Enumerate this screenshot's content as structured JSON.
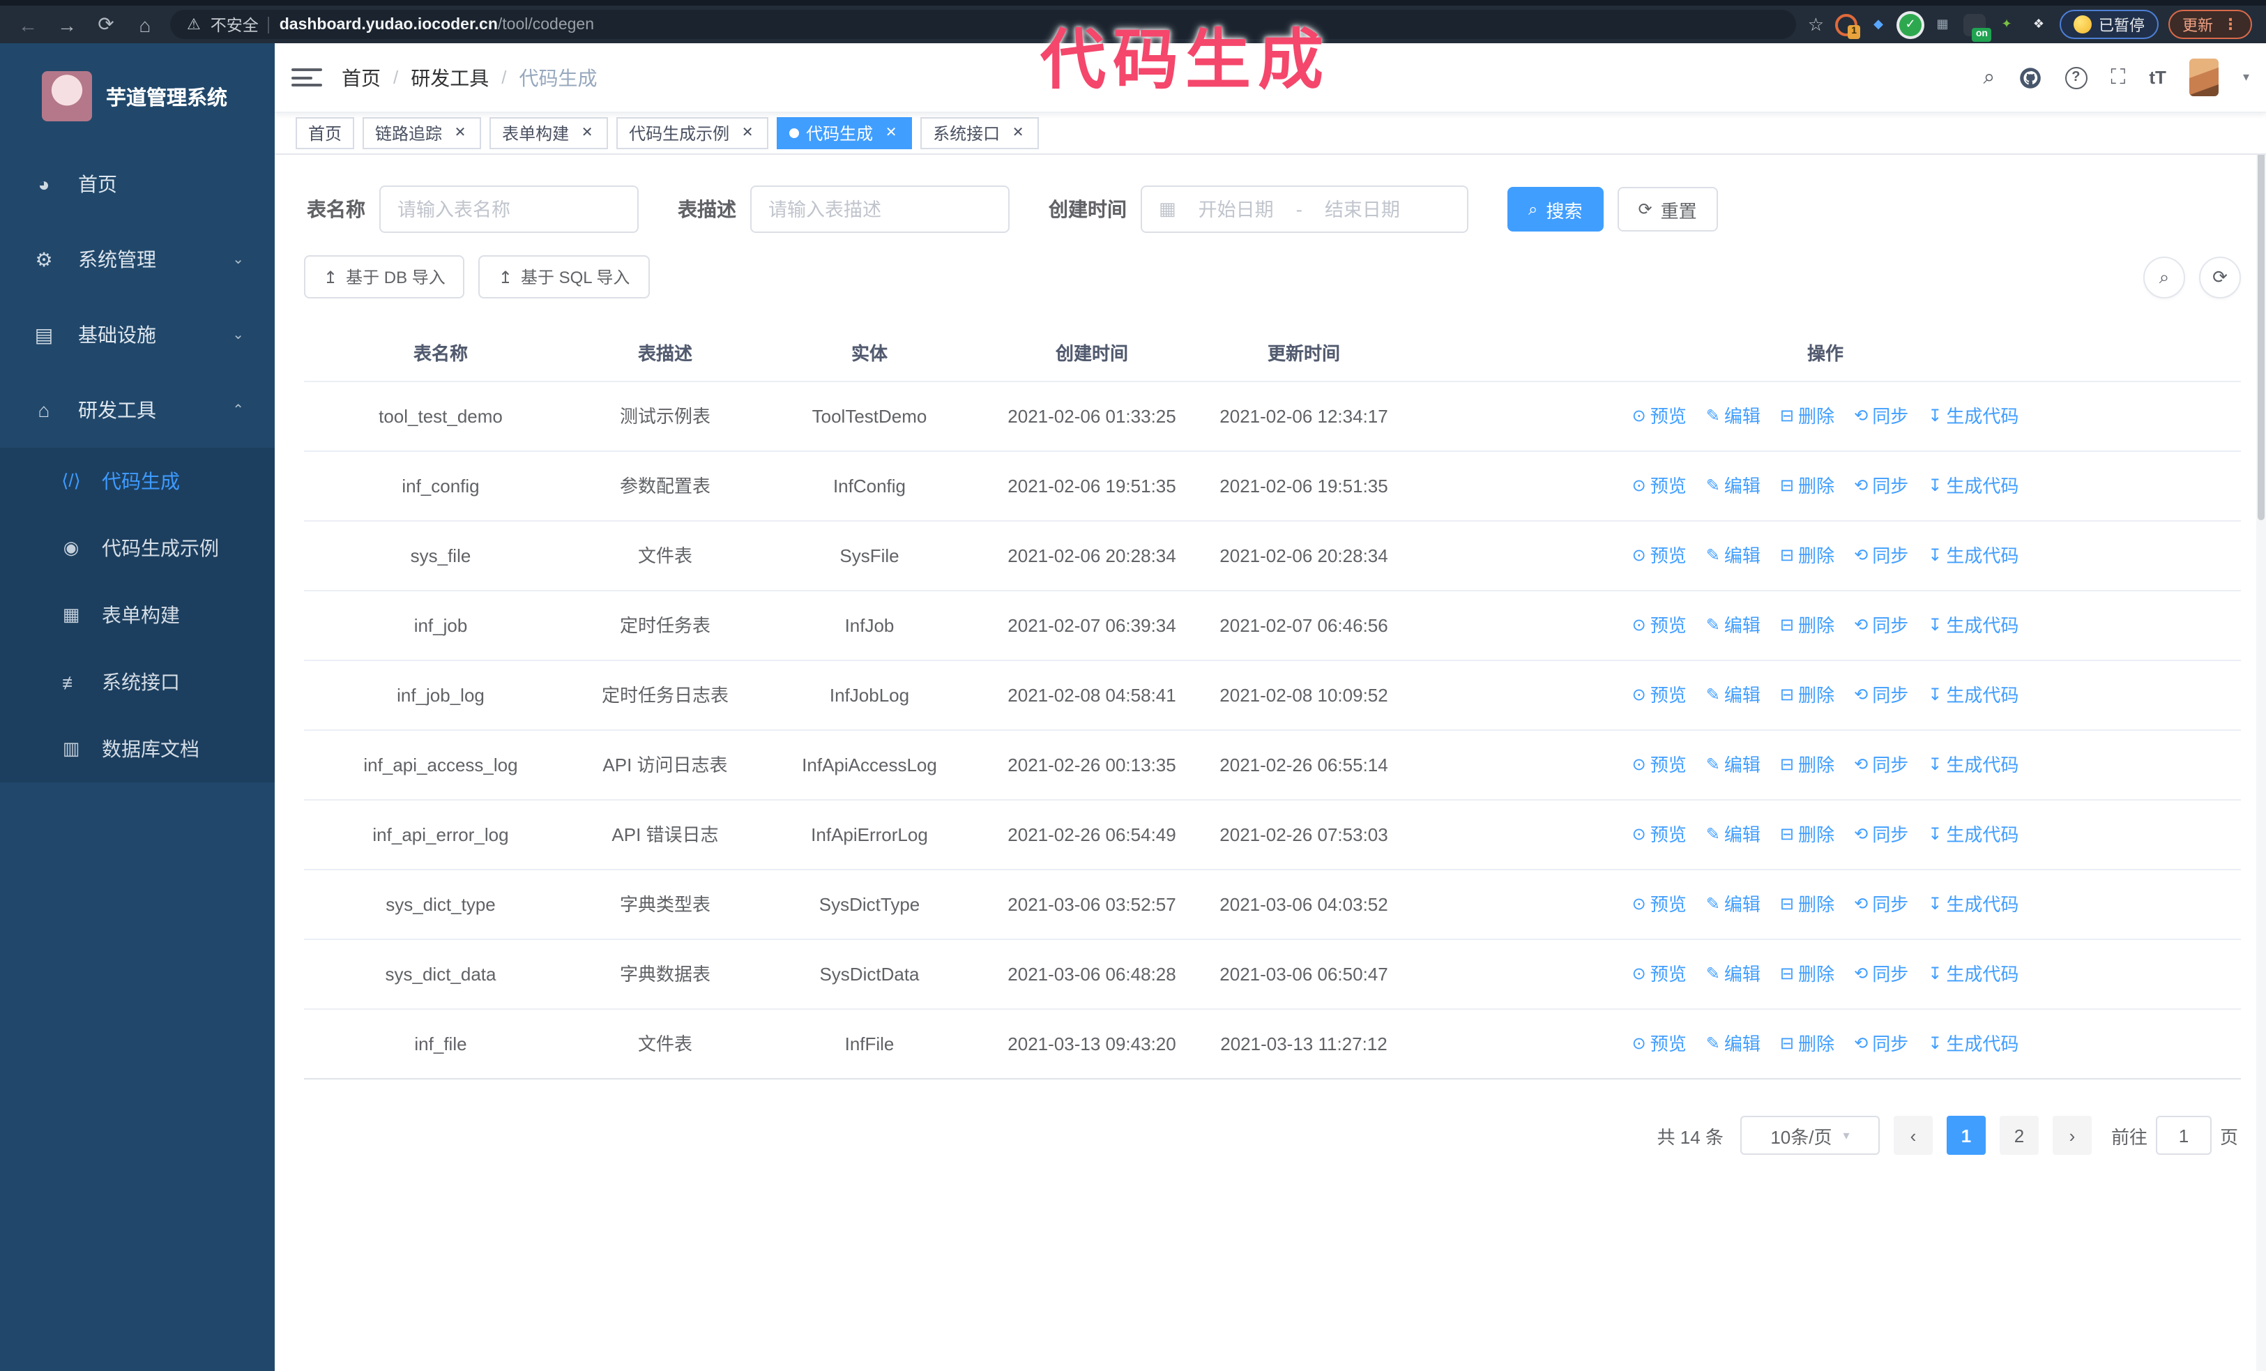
{
  "browser": {
    "security_label": "不安全",
    "url_host": "dashboard.yudao.iocoder.cn",
    "url_path": "/tool/codegen",
    "extension_badge": "1",
    "extension_on_badge": "on",
    "paused_chip": "已暂停",
    "update_chip": "更新",
    "icons": {
      "back": "←",
      "forward": "→",
      "reload": "⟳",
      "home": "⌂",
      "warning": "⚠",
      "star": "☆",
      "menu_dots": "⋮",
      "gem": "◆",
      "check": "✓",
      "grid": "▦",
      "sprout": "✦",
      "puzzle": "❖"
    }
  },
  "annotation": {
    "text": "代码生成"
  },
  "sidebar": {
    "app_title": "芋道管理系统",
    "items": [
      {
        "label": "首页",
        "icon": "dashboard-icon",
        "glyph": "◕"
      },
      {
        "label": "系统管理",
        "icon": "gear-icon",
        "glyph": "⚙",
        "chevron": "⌄"
      },
      {
        "label": "基础设施",
        "icon": "monitor-icon",
        "glyph": "▤",
        "chevron": "⌄"
      },
      {
        "label": "研发工具",
        "icon": "toolbox-icon",
        "glyph": "⌂",
        "chevron": "⌃"
      }
    ],
    "sub_items": [
      {
        "label": "代码生成",
        "icon": "code-icon",
        "glyph": "⟨/⟩",
        "active": true
      },
      {
        "label": "代码生成示例",
        "icon": "shield-check-icon",
        "glyph": "◉",
        "active": false
      },
      {
        "label": "表单构建",
        "icon": "form-icon",
        "glyph": "▦",
        "active": false
      },
      {
        "label": "系统接口",
        "icon": "sliders-icon",
        "glyph": "≢",
        "active": false
      },
      {
        "label": "数据库文档",
        "icon": "database-doc-icon",
        "glyph": "▥",
        "active": false
      }
    ]
  },
  "navbar": {
    "breadcrumb": [
      "首页",
      "研发工具",
      "代码生成"
    ],
    "separator": "/",
    "icons": {
      "search_glyph": "⌕",
      "fullscreen_glyph": "⛶",
      "fontsize_glyph": "tT",
      "help_glyph": "?",
      "caret": "▾"
    }
  },
  "tabs": [
    {
      "label": "首页",
      "closable": false,
      "active": false
    },
    {
      "label": "链路追踪",
      "closable": true,
      "active": false
    },
    {
      "label": "表单构建",
      "closable": true,
      "active": false
    },
    {
      "label": "代码生成示例",
      "closable": true,
      "active": false
    },
    {
      "label": "代码生成",
      "closable": true,
      "active": true
    },
    {
      "label": "系统接口",
      "closable": true,
      "active": false
    }
  ],
  "search": {
    "name_label": "表名称",
    "name_placeholder": "请输入表名称",
    "desc_label": "表描述",
    "desc_placeholder": "请输入表描述",
    "time_label": "创建时间",
    "start_placeholder": "开始日期",
    "range_separator": "-",
    "end_placeholder": "结束日期",
    "search_button": "搜索",
    "reset_button": "重置"
  },
  "toolbar": {
    "db_import_button": "基于 DB 导入",
    "sql_import_button": "基于 SQL 导入"
  },
  "table": {
    "columns": [
      "表名称",
      "表描述",
      "实体",
      "创建时间",
      "更新时间",
      "操作"
    ],
    "actions": [
      {
        "label": "预览",
        "icon": "eye-icon",
        "glyph": "⊙"
      },
      {
        "label": "编辑",
        "icon": "edit-icon",
        "glyph": "✎"
      },
      {
        "label": "删除",
        "icon": "trash-icon",
        "glyph": "⊟"
      },
      {
        "label": "同步",
        "icon": "sync-icon",
        "glyph": "⟲"
      },
      {
        "label": "生成代码",
        "icon": "download-icon",
        "glyph": "↧"
      }
    ],
    "rows": [
      {
        "name": "tool_test_demo",
        "desc": "测试示例表",
        "entity": "ToolTestDemo",
        "created": "2021-02-06 01:33:25",
        "updated": "2021-02-06 12:34:17"
      },
      {
        "name": "inf_config",
        "desc": "参数配置表",
        "entity": "InfConfig",
        "created": "2021-02-06 19:51:35",
        "updated": "2021-02-06 19:51:35"
      },
      {
        "name": "sys_file",
        "desc": "文件表",
        "entity": "SysFile",
        "created": "2021-02-06 20:28:34",
        "updated": "2021-02-06 20:28:34"
      },
      {
        "name": "inf_job",
        "desc": "定时任务表",
        "entity": "InfJob",
        "created": "2021-02-07 06:39:34",
        "updated": "2021-02-07 06:46:56"
      },
      {
        "name": "inf_job_log",
        "desc": "定时任务日志表",
        "entity": "InfJobLog",
        "created": "2021-02-08 04:58:41",
        "updated": "2021-02-08 10:09:52"
      },
      {
        "name": "inf_api_access_log",
        "desc": "API 访问日志表",
        "entity": "InfApiAccessLog",
        "created": "2021-02-26 00:13:35",
        "updated": "2021-02-26 06:55:14"
      },
      {
        "name": "inf_api_error_log",
        "desc": "API 错误日志",
        "entity": "InfApiErrorLog",
        "created": "2021-02-26 06:54:49",
        "updated": "2021-02-26 07:53:03"
      },
      {
        "name": "sys_dict_type",
        "desc": "字典类型表",
        "entity": "SysDictType",
        "created": "2021-03-06 03:52:57",
        "updated": "2021-03-06 04:03:52"
      },
      {
        "name": "sys_dict_data",
        "desc": "字典数据表",
        "entity": "SysDictData",
        "created": "2021-03-06 06:48:28",
        "updated": "2021-03-06 06:50:47"
      },
      {
        "name": "inf_file",
        "desc": "文件表",
        "entity": "InfFile",
        "created": "2021-03-13 09:43:20",
        "updated": "2021-03-13 11:27:12"
      }
    ]
  },
  "pagination": {
    "total_text": "共 14 条",
    "page_size_text": "10条/页",
    "prev_glyph": "‹",
    "next_glyph": "›",
    "pages": [
      {
        "label": "1",
        "active": true
      },
      {
        "label": "2",
        "active": false
      }
    ],
    "goto_label": "前往",
    "goto_value": "1",
    "page_unit": "页"
  },
  "colors": {
    "accent_blue": "#409EFF",
    "sidebar_bg": "#21486B",
    "submenu_bg": "#1D3F5F",
    "chrome_bg": "#232D39",
    "annotation_pink": "#F4476B",
    "table_border": "#EBEEF5",
    "breadcrumb_muted": "#97A8BE"
  }
}
